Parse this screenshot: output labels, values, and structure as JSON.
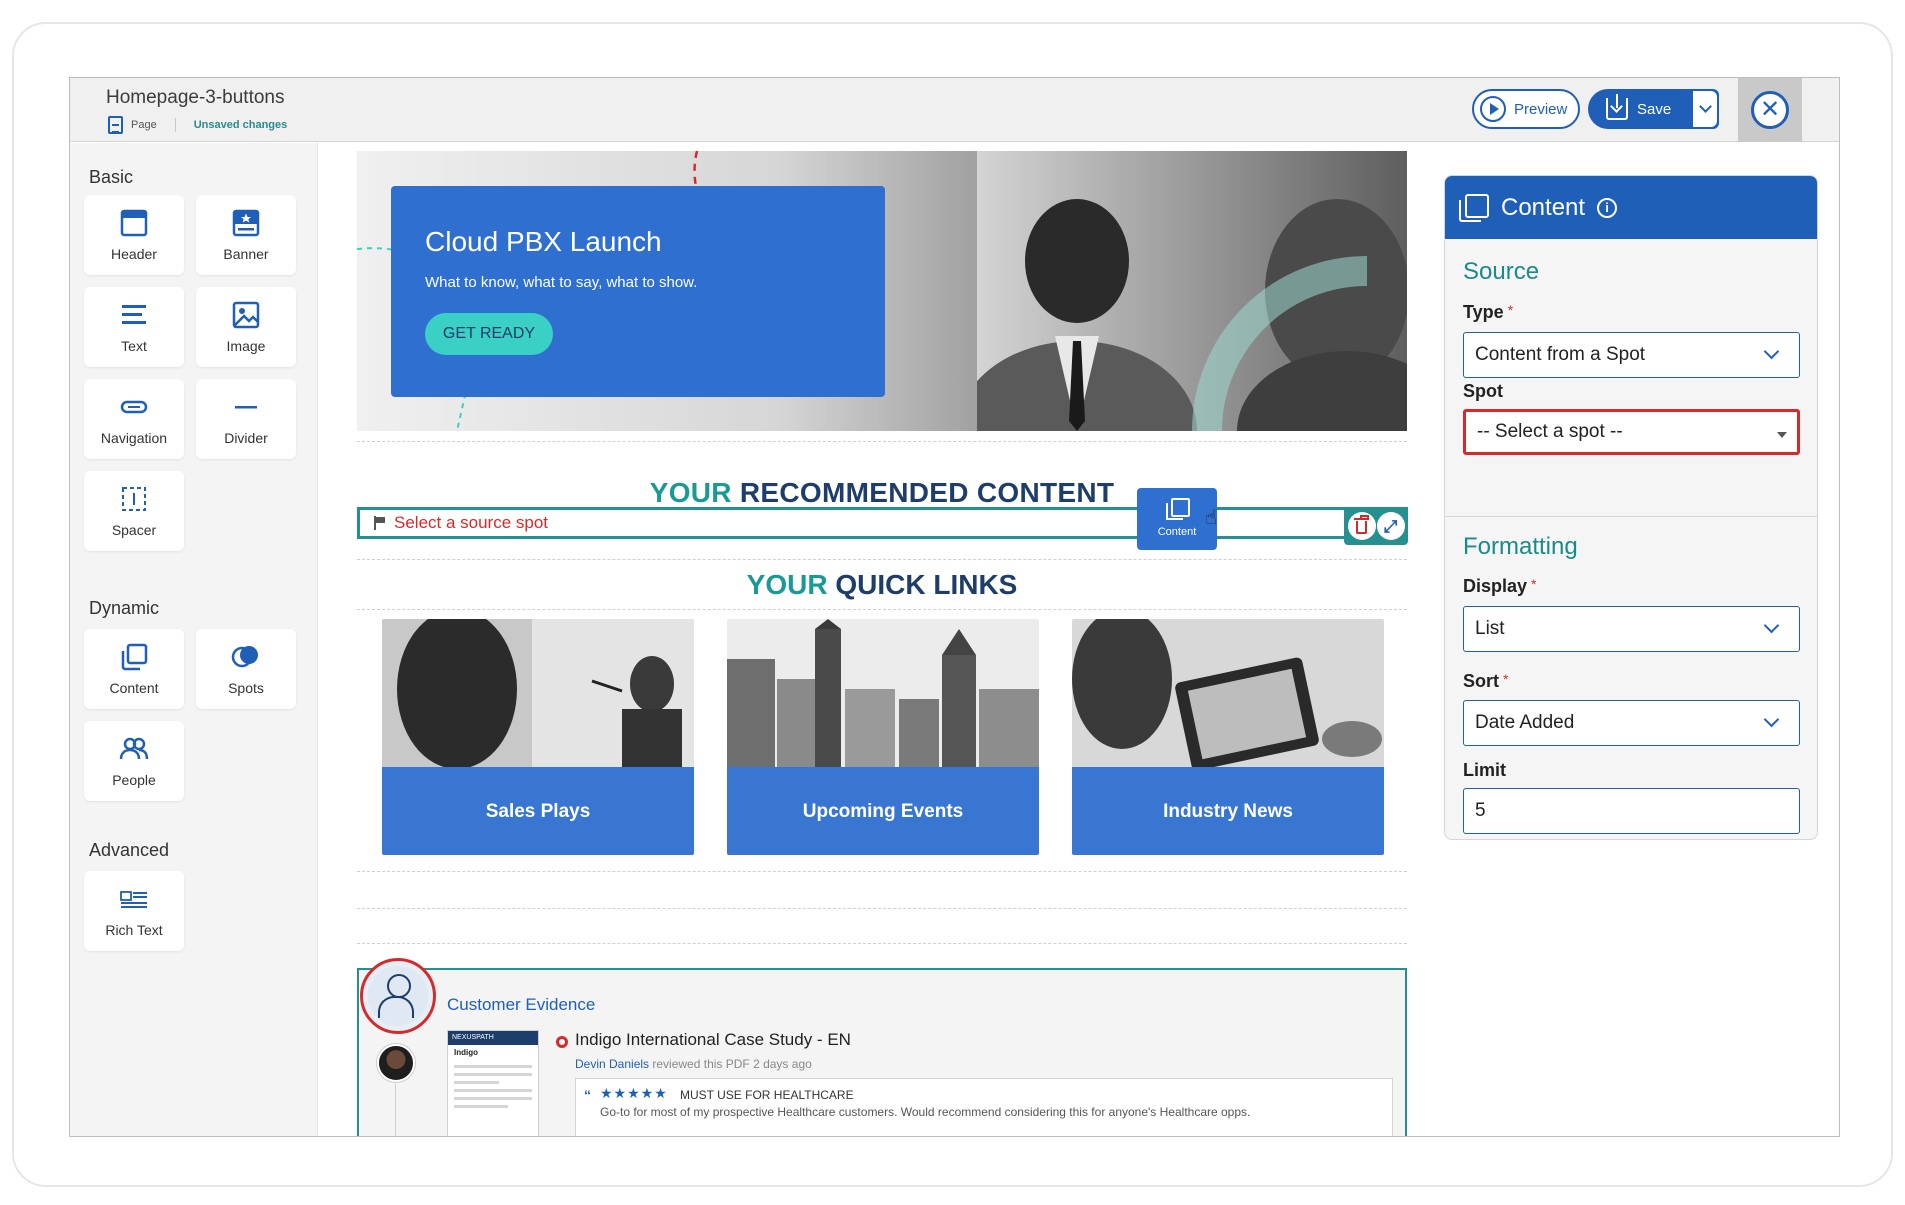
{
  "header": {
    "title": "Homepage-3-buttons",
    "page_label": "Page",
    "status": "Unsaved changes",
    "preview_label": "Preview",
    "save_label": "Save"
  },
  "palette": {
    "basic_heading": "Basic",
    "dynamic_heading": "Dynamic",
    "advanced_heading": "Advanced",
    "basic": [
      {
        "label": "Header",
        "icon": "header-icon"
      },
      {
        "label": "Banner",
        "icon": "banner-icon"
      },
      {
        "label": "Text",
        "icon": "text-icon"
      },
      {
        "label": "Image",
        "icon": "image-icon"
      },
      {
        "label": "Navigation",
        "icon": "navigation-icon"
      },
      {
        "label": "Divider",
        "icon": "divider-icon"
      },
      {
        "label": "Spacer",
        "icon": "spacer-icon"
      }
    ],
    "dynamic": [
      {
        "label": "Content",
        "icon": "content-icon"
      },
      {
        "label": "Spots",
        "icon": "spots-icon"
      },
      {
        "label": "People",
        "icon": "people-icon"
      }
    ],
    "advanced": [
      {
        "label": "Rich Text",
        "icon": "rich-text-icon"
      }
    ]
  },
  "canvas": {
    "hero": {
      "title": "Cloud PBX Launch",
      "subtitle": "What to know, what to say, what to show.",
      "cta": "GET READY"
    },
    "recommended": {
      "accent": "YOUR",
      "rest": " RECOMMENDED CONTENT",
      "warning": "Select a source spot",
      "chip_label": "Content"
    },
    "quick_links": {
      "accent": "YOUR",
      "rest": " QUICK LINKS",
      "cards": [
        {
          "label": "Sales Plays"
        },
        {
          "label": "Upcoming Events"
        },
        {
          "label": "Industry News"
        }
      ]
    },
    "evidence": {
      "title": "Customer Evidence",
      "thumb_brand": "NEXUSPATH",
      "thumb_title": "Indigo",
      "doc_title": "Indigo International Case Study - EN",
      "reviewer": "Devin Daniels",
      "review_meta": " reviewed this PDF 2 days ago",
      "stars": "★★★★★",
      "headline": "MUST USE FOR HEALTHCARE",
      "body": "Go-to for most of my prospective Healthcare customers. Would recommend considering this for anyone's Healthcare opps."
    }
  },
  "config": {
    "title": "Content",
    "source_heading": "Source",
    "type_label": "Type",
    "type_value": "Content from a Spot",
    "spot_label": "Spot",
    "spot_value": "-- Select a spot --",
    "formatting_heading": "Formatting",
    "display_label": "Display",
    "display_value": "List",
    "sort_label": "Sort",
    "sort_value": "Date Added",
    "limit_label": "Limit",
    "limit_value": "5"
  },
  "colors": {
    "brand_blue": "#1f5fb8",
    "teal": "#25908f",
    "error_red": "#d62a2a"
  }
}
